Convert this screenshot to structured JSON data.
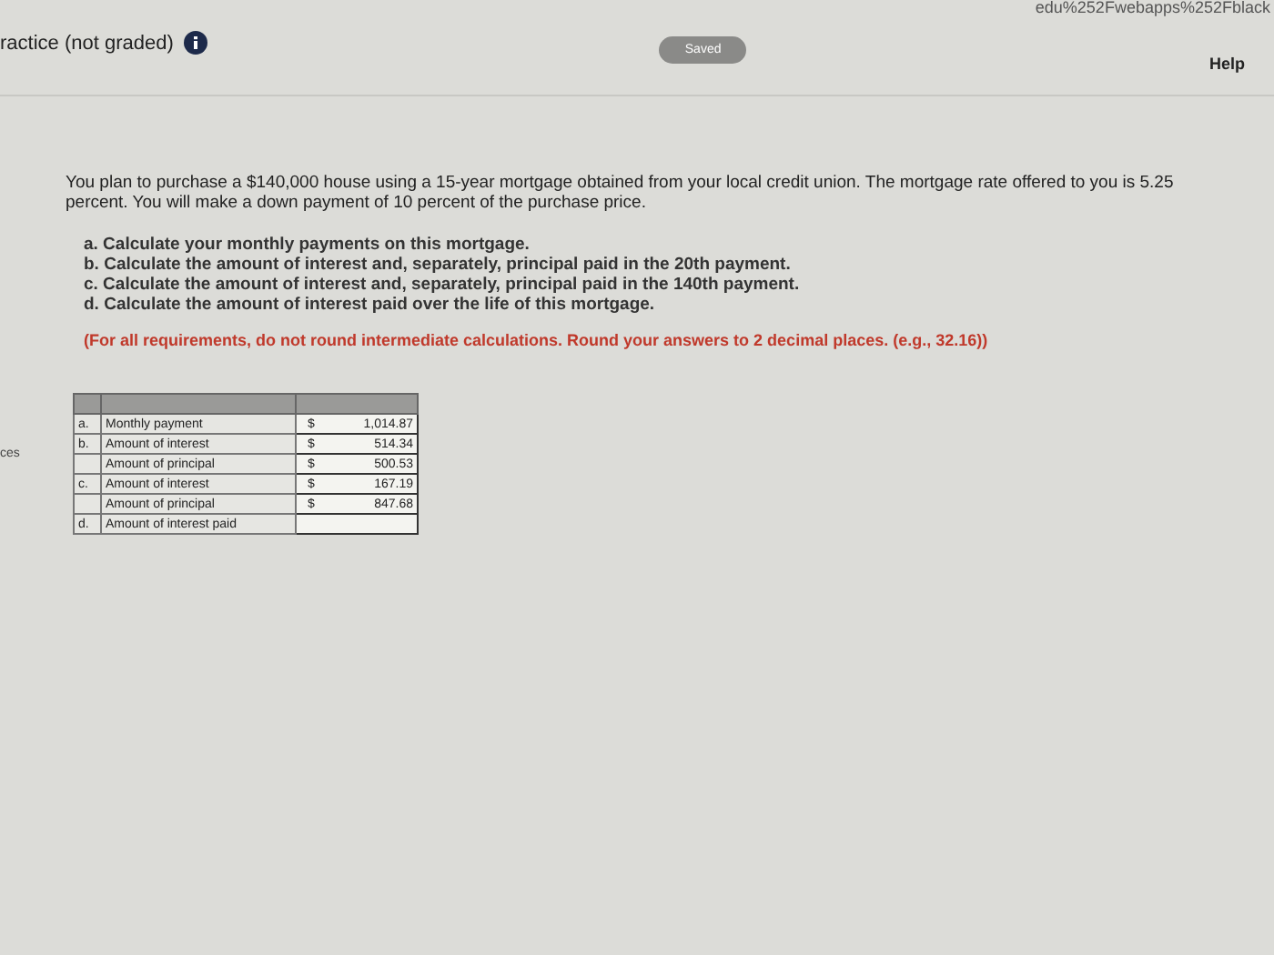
{
  "url_fragment": "edu%252Fwebapps%252Fblack",
  "header": {
    "title": "ractice (not graded)",
    "status": "Saved",
    "help": "Help"
  },
  "side_label": "ces",
  "question": {
    "intro": "You plan to purchase a $140,000 house using a 15-year mortgage obtained from your local credit union. The mortgage rate offered to you is 5.25 percent. You will make a down payment of 10 percent of the purchase price.",
    "parts": [
      "a. Calculate your monthly payments on this mortgage.",
      "b. Calculate the amount of interest and, separately, principal paid in the 20th payment.",
      "c. Calculate the amount of interest and, separately, principal paid in the 140th payment.",
      "d. Calculate the amount of interest paid over the life of this mortgage."
    ],
    "instruction": "(For all requirements, do not round intermediate calculations. Round your answers to 2 decimal places. (e.g., 32.16))"
  },
  "table": {
    "rows": [
      {
        "letter": "a.",
        "label": "Monthly payment",
        "currency": "$",
        "value": "1,014.87"
      },
      {
        "letter": "b.",
        "label": "Amount of interest",
        "currency": "$",
        "value": "514.34"
      },
      {
        "letter": "",
        "label": "Amount of principal",
        "currency": "$",
        "value": "500.53"
      },
      {
        "letter": "c.",
        "label": "Amount of interest",
        "currency": "$",
        "value": "167.19"
      },
      {
        "letter": "",
        "label": "Amount of principal",
        "currency": "$",
        "value": "847.68"
      },
      {
        "letter": "d.",
        "label": "Amount of interest paid",
        "currency": "",
        "value": ""
      }
    ]
  }
}
